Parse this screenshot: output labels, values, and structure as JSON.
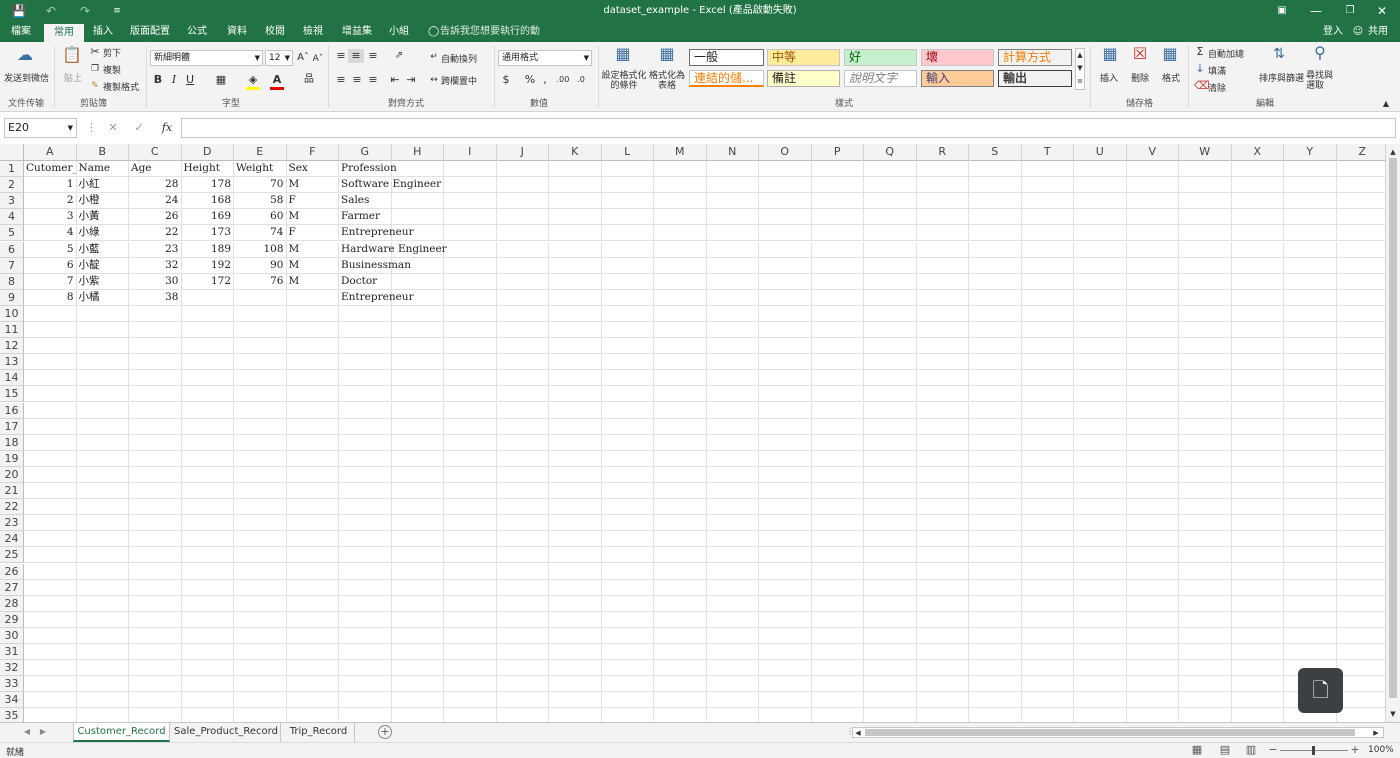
{
  "title_bar": {
    "title": "dataset_example - Excel (產品啟動失敗)"
  },
  "menu_tabs": [
    "檔案",
    "常用",
    "插入",
    "版面配置",
    "公式",
    "資料",
    "校閱",
    "檢視",
    "增益集",
    "小組"
  ],
  "tell_me": "告訴我您想要執行的動作...",
  "account": {
    "sign_in": "登入",
    "share": "共用"
  },
  "ribbon": {
    "send_wechat": "发送到微信",
    "paste": "貼上",
    "cut": "剪下",
    "copy": "複製",
    "format_painter": "複製格式",
    "font_name": "新細明體",
    "font_size": "12",
    "wrap_text": "自動換列",
    "merge_center": "跨欄置中",
    "number_format": "通用格式",
    "conditional_formatting": "設定格式化的條件",
    "format_as_table": "格式化為表格",
    "styles": [
      "一般",
      "中等",
      "好",
      "壞",
      "計算方式",
      "連結的儲...",
      "備註",
      "說明文字",
      "輸入",
      "輸出"
    ],
    "insert": "插入",
    "delete": "刪除",
    "format": "格式",
    "autosum": "自動加總",
    "fill": "填滿",
    "clear": "清除",
    "sort_filter": "排序與篩選",
    "find_select": "尋找與選取",
    "groups": [
      "文件传输",
      "剪貼簿",
      "字型",
      "對齊方式",
      "數值",
      "樣式",
      "儲存格",
      "編輯"
    ]
  },
  "name_box": "E20",
  "formula_value": "",
  "columns": [
    "A",
    "B",
    "C",
    "D",
    "E",
    "F",
    "G",
    "H",
    "I",
    "J",
    "K",
    "L",
    "M",
    "N",
    "O",
    "P",
    "Q",
    "R",
    "S",
    "T",
    "U",
    "V",
    "W",
    "X",
    "Y",
    "Z"
  ],
  "rows": [
    "1",
    "2",
    "3",
    "4",
    "5",
    "6",
    "7",
    "8",
    "9",
    "10",
    "11",
    "12",
    "13",
    "14",
    "15",
    "16",
    "17",
    "18",
    "19",
    "20",
    "21",
    "22",
    "23",
    "24",
    "25",
    "26",
    "27",
    "28",
    "29",
    "30",
    "31",
    "32",
    "33",
    "34",
    "35"
  ],
  "headers": [
    "Cutomer_id",
    "Name",
    "Age",
    "Height",
    "Weight",
    "Sex",
    "Profession"
  ],
  "records": [
    [
      "1",
      "小紅",
      "28",
      "178",
      "70",
      "M",
      "Software Engineer"
    ],
    [
      "2",
      "小橙",
      "24",
      "168",
      "58",
      "F",
      "Sales"
    ],
    [
      "3",
      "小黃",
      "26",
      "169",
      "60",
      "M",
      "Farmer"
    ],
    [
      "4",
      "小綠",
      "22",
      "173",
      "74",
      "F",
      "Entrepreneur"
    ],
    [
      "5",
      "小藍",
      "23",
      "189",
      "108",
      "M",
      "Hardware Engineer"
    ],
    [
      "6",
      "小靛",
      "32",
      "192",
      "90",
      "M",
      "Businessman"
    ],
    [
      "7",
      "小紫",
      "30",
      "172",
      "76",
      "M",
      "Doctor"
    ],
    [
      "8",
      "小橘",
      "38",
      "",
      "",
      "",
      "Entrepreneur"
    ]
  ],
  "sheets": [
    "Customer_Record",
    "Sale_Product_Record",
    "Trip_Record"
  ],
  "active_sheet": "Customer_Record",
  "status": {
    "ready": "就緒",
    "zoom": "100%"
  }
}
